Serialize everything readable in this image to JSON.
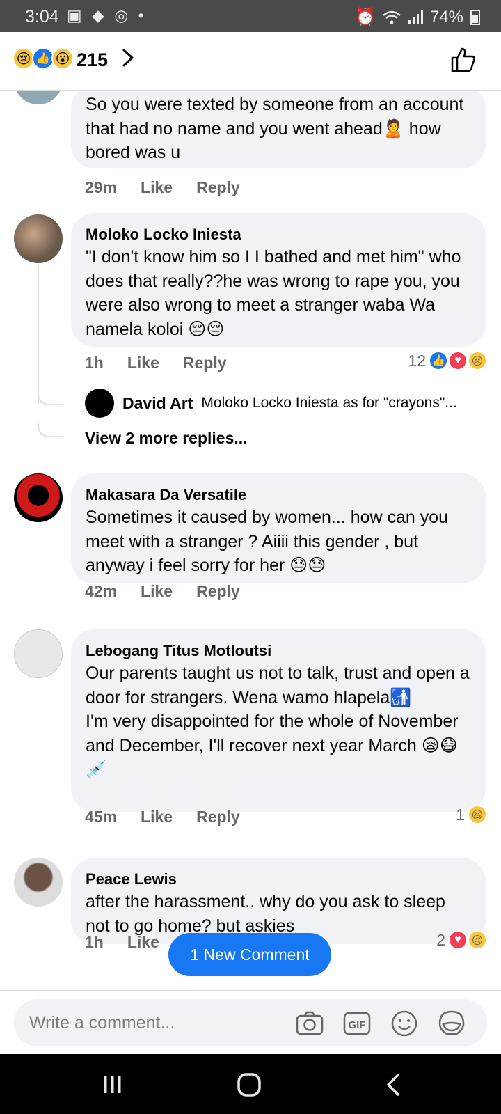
{
  "status_bar": {
    "time": "3:04",
    "notif_icons": "▣ ◆ ◎ •",
    "battery": "74%"
  },
  "header": {
    "reaction_count": "215",
    "reactions": [
      "sad",
      "like",
      "wow"
    ]
  },
  "comments": [
    {
      "text": "So you were texted by someone from an account that had no name and you went ahead🙎 how bored was u",
      "time": "29m",
      "like": "Like",
      "reply": "Reply"
    },
    {
      "author": "Moloko Locko Iniesta",
      "text": "\"I don't know him so I I bathed and met him\" who does that really??he was wrong to rape you, you were also wrong to meet a stranger waba Wa namela koloi 😔😔",
      "time": "1h",
      "like": "Like",
      "reply": "Reply",
      "reaction_count": "12",
      "reactions": [
        "like",
        "love",
        "sad"
      ],
      "reply_preview": {
        "author": "David Art",
        "text": "Moloko Locko Iniesta as for \"crayons\"..."
      },
      "view_more": "View 2 more replies..."
    },
    {
      "author": "Makasara Da Versatile",
      "text": "Sometimes it caused by women... how can you meet with a stranger ? Aiiii this gender , but anyway i feel sorry for her 😓😓",
      "time": "42m",
      "like": "Like",
      "reply": "Reply"
    },
    {
      "author": "Lebogang Titus Motloutsi",
      "text_lines": [
        "Our parents taught us not to talk, trust and open a door for strangers. Wena wamo hlapela🚮",
        "I'm very disappointed for the whole of November and December, I'll recover next year March 😪😷💉"
      ],
      "time": "45m",
      "like": "Like",
      "reply": "Reply",
      "reaction_count": "1",
      "reactions": [
        "haha"
      ]
    },
    {
      "author": "Peace Lewis",
      "text": "after the harassment.. why do you ask to sleep not to go home? but askies",
      "time": "1h",
      "like": "Like",
      "reaction_count": "2",
      "reactions": [
        "love",
        "sad"
      ]
    }
  ],
  "new_comment_label": "1 New Comment",
  "composer": {
    "placeholder": "Write a comment...",
    "icons": [
      "camera-icon",
      "gif-icon",
      "emoji-icon",
      "sticker-icon"
    ]
  },
  "colors": {
    "accent": "#1877f2",
    "bubble": "#f0f2f5",
    "meta": "#65676b"
  }
}
